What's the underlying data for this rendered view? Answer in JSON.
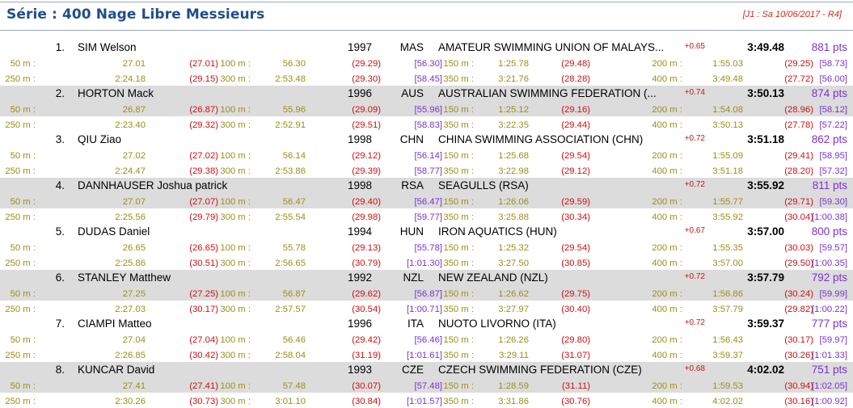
{
  "header": {
    "title": "Série : 400 Nage Libre Messieurs",
    "meta": "[J1 : Sa 10/06/2017 - R4]"
  },
  "swimmers": [
    {
      "rank": "1.",
      "name": "SIM Welson",
      "year": "1997",
      "nation": "MAS",
      "club": "AMATEUR SWIMMING UNION OF MALAYS...",
      "reaction": "+0.65",
      "time": "3:49.48",
      "points": "881 pts",
      "splits": [
        {
          "label": "50 m :",
          "cum": "27.01",
          "lap": "(27.01)"
        },
        {
          "label": "100 m :",
          "cum": "56.30",
          "lap": "(29.29)",
          "sub": "[56.30]"
        },
        {
          "label": "150 m :",
          "cum": "1:25.78",
          "lap": "(29.48)"
        },
        {
          "label": "200 m :",
          "cum": "1:55.03",
          "lap": "(29.25)",
          "sub": "[58.73]"
        },
        {
          "label": "250 m :",
          "cum": "2:24.18",
          "lap": "(29.15)"
        },
        {
          "label": "300 m :",
          "cum": "2:53.48",
          "lap": "(29.30)",
          "sub": "[58.45]"
        },
        {
          "label": "350 m :",
          "cum": "3:21.76",
          "lap": "(28.28)"
        },
        {
          "label": "400 m :",
          "cum": "3:49.48",
          "lap": "(27.72)",
          "sub": "[56.00]"
        }
      ]
    },
    {
      "rank": "2.",
      "name": "HORTON Mack",
      "year": "1996",
      "nation": "AUS",
      "club": "AUSTRALIAN SWIMMING FEDERATION (...",
      "reaction": "+0.74",
      "time": "3:50.13",
      "points": "874 pts",
      "splits": [
        {
          "label": "50 m :",
          "cum": "26.87",
          "lap": "(26.87)"
        },
        {
          "label": "100 m :",
          "cum": "55.96",
          "lap": "(29.09)",
          "sub": "[55.96]"
        },
        {
          "label": "150 m :",
          "cum": "1:25.12",
          "lap": "(29.16)"
        },
        {
          "label": "200 m :",
          "cum": "1:54.08",
          "lap": "(28.96)",
          "sub": "[58.12]"
        },
        {
          "label": "250 m :",
          "cum": "2:23.40",
          "lap": "(29.32)"
        },
        {
          "label": "300 m :",
          "cum": "2:52.91",
          "lap": "(29.51)",
          "sub": "[58.83]"
        },
        {
          "label": "350 m :",
          "cum": "3:22.35",
          "lap": "(29.44)"
        },
        {
          "label": "400 m :",
          "cum": "3:50.13",
          "lap": "(27.78)",
          "sub": "[57.22]"
        }
      ]
    },
    {
      "rank": "3.",
      "name": "QIU Ziao",
      "year": "1998",
      "nation": "CHN",
      "club": "CHINA SWIMMING ASSOCIATION (CHN)",
      "reaction": "+0.72",
      "time": "3:51.18",
      "points": "862 pts",
      "splits": [
        {
          "label": "50 m :",
          "cum": "27.02",
          "lap": "(27.02)"
        },
        {
          "label": "100 m :",
          "cum": "56.14",
          "lap": "(29.12)",
          "sub": "[56.14]"
        },
        {
          "label": "150 m :",
          "cum": "1:25.68",
          "lap": "(29.54)"
        },
        {
          "label": "200 m :",
          "cum": "1:55.09",
          "lap": "(29.41)",
          "sub": "[58.95]"
        },
        {
          "label": "250 m :",
          "cum": "2:24.47",
          "lap": "(29.38)"
        },
        {
          "label": "300 m :",
          "cum": "2:53.86",
          "lap": "(29.39)",
          "sub": "[58.77]"
        },
        {
          "label": "350 m :",
          "cum": "3:22.98",
          "lap": "(29.12)"
        },
        {
          "label": "400 m :",
          "cum": "3:51.18",
          "lap": "(28.20)",
          "sub": "[57.32]"
        }
      ]
    },
    {
      "rank": "4.",
      "name": "DANNHAUSER Joshua patrick",
      "year": "1998",
      "nation": "RSA",
      "club": "SEAGULLS (RSA)",
      "reaction": "+0.72",
      "time": "3:55.92",
      "points": "811 pts",
      "splits": [
        {
          "label": "50 m :",
          "cum": "27.07",
          "lap": "(27.07)"
        },
        {
          "label": "100 m :",
          "cum": "56.47",
          "lap": "(29.40)",
          "sub": "[56.47]"
        },
        {
          "label": "150 m :",
          "cum": "1:26.06",
          "lap": "(29.59)"
        },
        {
          "label": "200 m :",
          "cum": "1:55.77",
          "lap": "(29.71)",
          "sub": "[59.30]"
        },
        {
          "label": "250 m :",
          "cum": "2:25.56",
          "lap": "(29.79)"
        },
        {
          "label": "300 m :",
          "cum": "2:55.54",
          "lap": "(29.98)",
          "sub": "[59.77]"
        },
        {
          "label": "350 m :",
          "cum": "3:25.88",
          "lap": "(30.34)"
        },
        {
          "label": "400 m :",
          "cum": "3:55.92",
          "lap": "(30.04)",
          "sub": "[1:00.38]"
        }
      ]
    },
    {
      "rank": "5.",
      "name": "DUDAS Daniel",
      "year": "1994",
      "nation": "HUN",
      "club": "IRON AQUATICS (HUN)",
      "reaction": "+0.67",
      "time": "3:57.00",
      "points": "800 pts",
      "splits": [
        {
          "label": "50 m :",
          "cum": "26.65",
          "lap": "(26.65)"
        },
        {
          "label": "100 m :",
          "cum": "55.78",
          "lap": "(29.13)",
          "sub": "[55.78]"
        },
        {
          "label": "150 m :",
          "cum": "1:25.32",
          "lap": "(29.54)"
        },
        {
          "label": "200 m :",
          "cum": "1:55.35",
          "lap": "(30.03)",
          "sub": "[59.57]"
        },
        {
          "label": "250 m :",
          "cum": "2:25.86",
          "lap": "(30.51)"
        },
        {
          "label": "300 m :",
          "cum": "2:56.65",
          "lap": "(30.79)",
          "sub": "[1:01.30]"
        },
        {
          "label": "350 m :",
          "cum": "3:27.50",
          "lap": "(30.85)"
        },
        {
          "label": "400 m :",
          "cum": "3:57.00",
          "lap": "(29.50)",
          "sub": "[1:00.35]"
        }
      ]
    },
    {
      "rank": "6.",
      "name": "STANLEY Matthew",
      "year": "1992",
      "nation": "NZL",
      "club": "NEW ZEALAND (NZL)",
      "reaction": "+0.72",
      "time": "3:57.79",
      "points": "792 pts",
      "splits": [
        {
          "label": "50 m :",
          "cum": "27.25",
          "lap": "(27.25)"
        },
        {
          "label": "100 m :",
          "cum": "56.87",
          "lap": "(29.62)",
          "sub": "[56.87]"
        },
        {
          "label": "150 m :",
          "cum": "1:26.62",
          "lap": "(29.75)"
        },
        {
          "label": "200 m :",
          "cum": "1:56.86",
          "lap": "(30.24)",
          "sub": "[59.99]"
        },
        {
          "label": "250 m :",
          "cum": "2:27.03",
          "lap": "(30.17)"
        },
        {
          "label": "300 m :",
          "cum": "2:57.57",
          "lap": "(30.54)",
          "sub": "[1:00.71]"
        },
        {
          "label": "350 m :",
          "cum": "3:27.97",
          "lap": "(30.40)"
        },
        {
          "label": "400 m :",
          "cum": "3:57.79",
          "lap": "(29.82)",
          "sub": "[1:00.22]"
        }
      ]
    },
    {
      "rank": "7.",
      "name": "CIAMPI Matteo",
      "year": "1996",
      "nation": "ITA",
      "club": "NUOTO LIVORNO (ITA)",
      "reaction": "+0.72",
      "time": "3:59.37",
      "points": "777 pts",
      "splits": [
        {
          "label": "50 m :",
          "cum": "27.04",
          "lap": "(27.04)"
        },
        {
          "label": "100 m :",
          "cum": "56.46",
          "lap": "(29.42)",
          "sub": "[56.46]"
        },
        {
          "label": "150 m :",
          "cum": "1:26.26",
          "lap": "(29.80)"
        },
        {
          "label": "200 m :",
          "cum": "1:56.43",
          "lap": "(30.17)",
          "sub": "[59.97]"
        },
        {
          "label": "250 m :",
          "cum": "2:26.85",
          "lap": "(30.42)"
        },
        {
          "label": "300 m :",
          "cum": "2:58.04",
          "lap": "(31.19)",
          "sub": "[1:01.61]"
        },
        {
          "label": "350 m :",
          "cum": "3:29.11",
          "lap": "(31.07)"
        },
        {
          "label": "400 m :",
          "cum": "3:59.37",
          "lap": "(30.26)",
          "sub": "[1:01.33]"
        }
      ]
    },
    {
      "rank": "8.",
      "name": "KUNCAR David",
      "year": "1993",
      "nation": "CZE",
      "club": "CZECH SWIMMING FEDERATION (CZE)",
      "reaction": "+0.68",
      "time": "4:02.02",
      "points": "751 pts",
      "splits": [
        {
          "label": "50 m :",
          "cum": "27.41",
          "lap": "(27.41)"
        },
        {
          "label": "100 m :",
          "cum": "57.48",
          "lap": "(30.07)",
          "sub": "[57.48]"
        },
        {
          "label": "150 m :",
          "cum": "1:28.59",
          "lap": "(31.11)"
        },
        {
          "label": "200 m :",
          "cum": "1:59.53",
          "lap": "(30.94)",
          "sub": "[1:02.05]"
        },
        {
          "label": "250 m :",
          "cum": "2:30.26",
          "lap": "(30.73)"
        },
        {
          "label": "300 m :",
          "cum": "3:01.10",
          "lap": "(30.84)",
          "sub": "[1:01.57]"
        },
        {
          "label": "350 m :",
          "cum": "3:31.86",
          "lap": "(30.76)"
        },
        {
          "label": "400 m :",
          "cum": "4:02.02",
          "lap": "(30.16)",
          "sub": "[1:00.92]"
        }
      ]
    }
  ]
}
